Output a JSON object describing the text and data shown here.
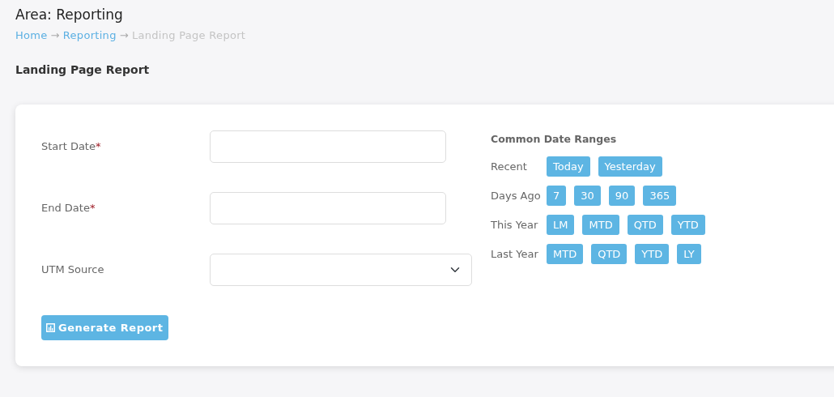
{
  "page_title": "Area: Reporting",
  "breadcrumb": [
    {
      "text": "Home",
      "kind": "link"
    },
    {
      "text": "→",
      "kind": "separator"
    },
    {
      "text": "Reporting",
      "kind": "link"
    },
    {
      "text": "→",
      "kind": "separator"
    },
    {
      "text": "Landing Page Report",
      "kind": "current"
    }
  ],
  "report_title": "Landing Page Report",
  "fields": [
    {
      "label": "Start Date",
      "required_mark": "*",
      "kind": "text"
    },
    {
      "label": "End Date",
      "required_mark": "*",
      "kind": "text"
    },
    {
      "label": "UTM Source",
      "kind": "select"
    }
  ],
  "generate_button": "Generate Report",
  "date_ranges": {
    "title": "Common Date Ranges",
    "groups": [
      {
        "label": "Recent",
        "buttons": [
          "Today",
          "Yesterday"
        ]
      },
      {
        "label": "Days Ago",
        "buttons": [
          "7",
          "30",
          "90",
          "365"
        ]
      },
      {
        "label": "This Year",
        "buttons": [
          "LM",
          "MTD",
          "QTD",
          "YTD"
        ]
      },
      {
        "label": "Last Year",
        "buttons": [
          "MTD",
          "QTD",
          "YTD",
          "LY"
        ]
      }
    ]
  }
}
